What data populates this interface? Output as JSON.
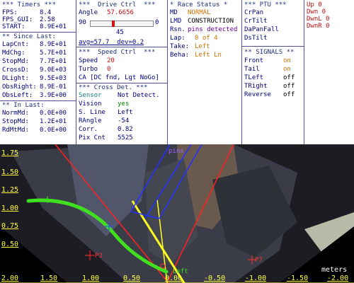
{
  "timers": {
    "header": "*** Timers ***",
    "rows": [
      {
        "label": "FPS:",
        "value": "8.4"
      },
      {
        "label": "FPS_GUI:",
        "value": "2.58"
      },
      {
        "label": "START:",
        "value": "8.9E+01"
      }
    ],
    "since_header": "** Since Last:",
    "since_rows": [
      {
        "label": "LapCnt:",
        "value": "8.9E+01"
      },
      {
        "label": "MdChg:",
        "value": "5.7E+01"
      },
      {
        "label": "StopMd:",
        "value": "7.7E+01"
      },
      {
        "label": "CrossD:",
        "value": "9.0E+03"
      },
      {
        "label": "DLight:",
        "value": "9.5E+03"
      },
      {
        "label": "ObsRight:",
        "value": "8.9E-01"
      },
      {
        "label": "ObsLeft:",
        "value": "3.9E+00"
      }
    ],
    "in_header": "** In Last:",
    "in_rows": [
      {
        "label": "NormMd:",
        "value": "0.0E+00"
      },
      {
        "label": "StopMd:",
        "value": "1.2E+01"
      },
      {
        "label": "RdMtMd:",
        "value": "0.0E+00"
      }
    ]
  },
  "drive": {
    "header": "***  Drive Ctrl  ***",
    "angle_label": "Angle",
    "angle_value": "57.6656",
    "slider_min": "90",
    "slider_max": "0",
    "slider_mid": "45",
    "angle_fraction": 0.36,
    "avg_text": "avg=57.7  dev=0.2"
  },
  "speed": {
    "header": "***  Speed Ctrl  ***",
    "speed_label": "Speed",
    "speed_value": "20",
    "turbo_label": "Turbo",
    "turbo_value": "0",
    "ca_text": "CA [DC fnd, Lgt NoGo]"
  },
  "cross": {
    "header": "*** Cross Det. ***",
    "rows": [
      {
        "label": "Sensor",
        "value": "Not Detect."
      },
      {
        "label": "Vision",
        "value": "yes"
      },
      {
        "label": "S. Line",
        "value": "Left"
      },
      {
        "label": "RAngle",
        "value": "-54"
      },
      {
        "label": "Corr.",
        "value": "0.82"
      },
      {
        "label": "Pix Cnt",
        "value": "5525"
      }
    ]
  },
  "race": {
    "header": "* Race Status *",
    "rows": [
      {
        "label": "MD",
        "value": "NORMAL"
      },
      {
        "label": "LMD",
        "value": "CONSTRUCTION"
      },
      {
        "label": "Rsn.",
        "value": "pins detected"
      },
      {
        "label": "Lap:",
        "value": "0 of 4"
      },
      {
        "label": "Take:",
        "value": "Left"
      },
      {
        "label": "Beha:",
        "value": "Left Ln"
      }
    ]
  },
  "ptu": {
    "header": "*** PTU ***",
    "items": [
      "CrPan",
      "CrTilt",
      "DaPanFall",
      "DsTilt"
    ]
  },
  "signals": {
    "header": "** SIGNALS **",
    "rows": [
      {
        "label": "Front",
        "value": "on"
      },
      {
        "label": "Tail",
        "value": "on"
      },
      {
        "label": "TLeft",
        "value": "off"
      },
      {
        "label": "TRight",
        "value": "off"
      },
      {
        "label": "Reverse",
        "value": "off"
      }
    ]
  },
  "status_corner": {
    "rows": [
      "Up 0",
      "Dwn 0",
      "DwnL 0",
      "DwnR 0"
    ]
  },
  "view": {
    "y_ticks": [
      "1.75",
      "1.50",
      "1.25",
      "1.00",
      "0.75",
      "0.50"
    ],
    "x_ticks": [
      "2.00",
      "1.50",
      "1.00",
      "0.50",
      "0.00",
      "-0.50",
      "-1.00",
      "-1.50",
      "-2.00"
    ],
    "unit_label": "meters",
    "marker_labels": [
      "P3",
      "P7",
      "pins",
      "Left"
    ]
  },
  "colors": {
    "panel_text": "#000080",
    "highlight_red": "#c01010",
    "highlight_orange": "#d07000",
    "highlight_green": "#008000",
    "path_green": "#40e020",
    "guide_yellow": "#ffff20",
    "guide_red": "#ff2020",
    "guide_blue": "#2030ff"
  }
}
